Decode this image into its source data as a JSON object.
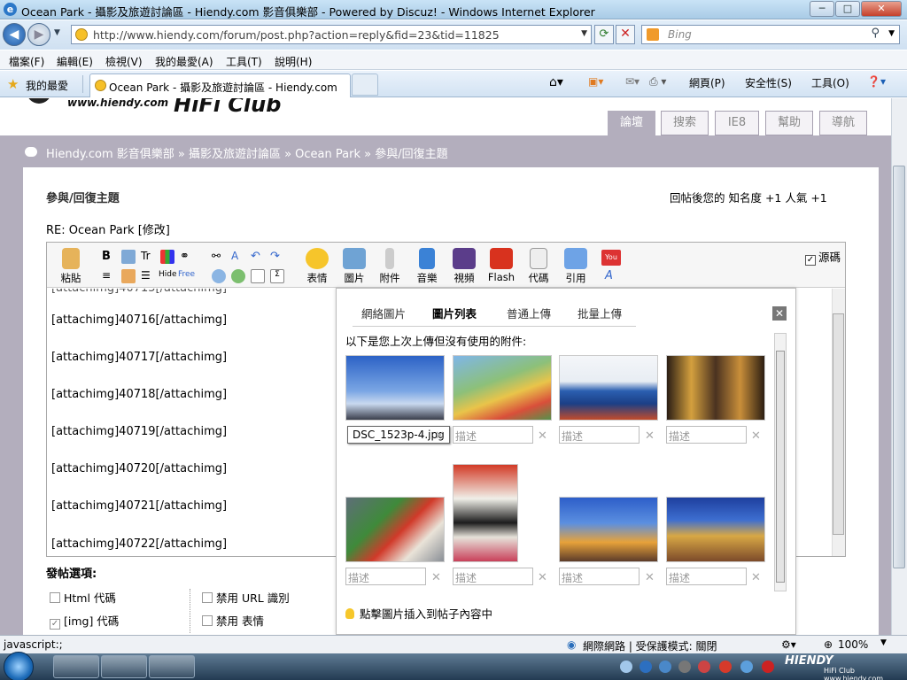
{
  "window": {
    "title": "Ocean Park - 攝影及旅遊討論區 - Hiendy.com 影音俱樂部 - Powered by Discuz! - Windows Internet Explorer",
    "min": "─",
    "max": "□",
    "close": "✕"
  },
  "address": {
    "url": "http://www.hiendy.com/forum/post.php?action=reply&fid=23&tid=11825",
    "search_placeholder": "Bing"
  },
  "menu": [
    "檔案(F)",
    "編輯(E)",
    "檢視(V)",
    "我的最愛(A)",
    "工具(T)",
    "說明(H)"
  ],
  "favorites_label": "我的最愛",
  "tab_title": "Ocean Park - 攝影及旅遊討論區 - Hiendy.com ...",
  "commands": {
    "page": "網頁(P)",
    "safety": "安全性(S)",
    "tools": "工具(O)"
  },
  "site": {
    "logo_small": "www.hiendy.com",
    "logo_big": "HiFi Club",
    "nav_tabs": [
      "論壇",
      "搜索",
      "IE8",
      "幫助",
      "導航"
    ],
    "breadcrumb": "Hiendy.com 影音俱樂部 » 攝影及旅遊討論區 » Ocean Park » 參與/回復主題"
  },
  "post": {
    "heading": "參與/回復主題",
    "reward": "回帖後您的 知名度 +1  人氣 +1",
    "subject": "RE: Ocean Park [修改]"
  },
  "toolbar": {
    "paste": "粘貼",
    "emoticon": "表情",
    "image": "圖片",
    "attachment": "附件",
    "music": "音樂",
    "video": "視頻",
    "flash": "Flash",
    "code": "代碼",
    "quote": "引用",
    "source": "源碼"
  },
  "editor_lines": [
    "[attachimg]40716[/attachimg]",
    "[attachimg]40717[/attachimg]",
    "[attachimg]40718[/attachimg]",
    "[attachimg]40719[/attachimg]",
    "[attachimg]40720[/attachimg]",
    "[attachimg]40721[/attachimg]",
    "[attachimg]40722[/attachimg]"
  ],
  "popup": {
    "tabs": [
      "網絡圖片",
      "圖片列表",
      "普通上傳",
      "批量上傳"
    ],
    "note": "以下是您上次上傳但沒有使用的附件:",
    "desc_placeholder": "描述",
    "tooltip": "DSC_1523p-4.jpg",
    "hint": "點擊圖片插入到帖子內容中"
  },
  "options": {
    "title": "發帖選項:",
    "html_code": "Html 代碼",
    "img_code": "[img] 代碼",
    "disable_url": "禁用 URL 識別",
    "disable_emoticon": "禁用 表情"
  },
  "status": {
    "left": "javascript:;",
    "zone": "網際網路 | 受保護模式: 關閉",
    "zoom": "100%"
  },
  "taskbar": {
    "brand": "HIENDY",
    "brand_sub": "HiFi Club  www.hiendy.com"
  }
}
